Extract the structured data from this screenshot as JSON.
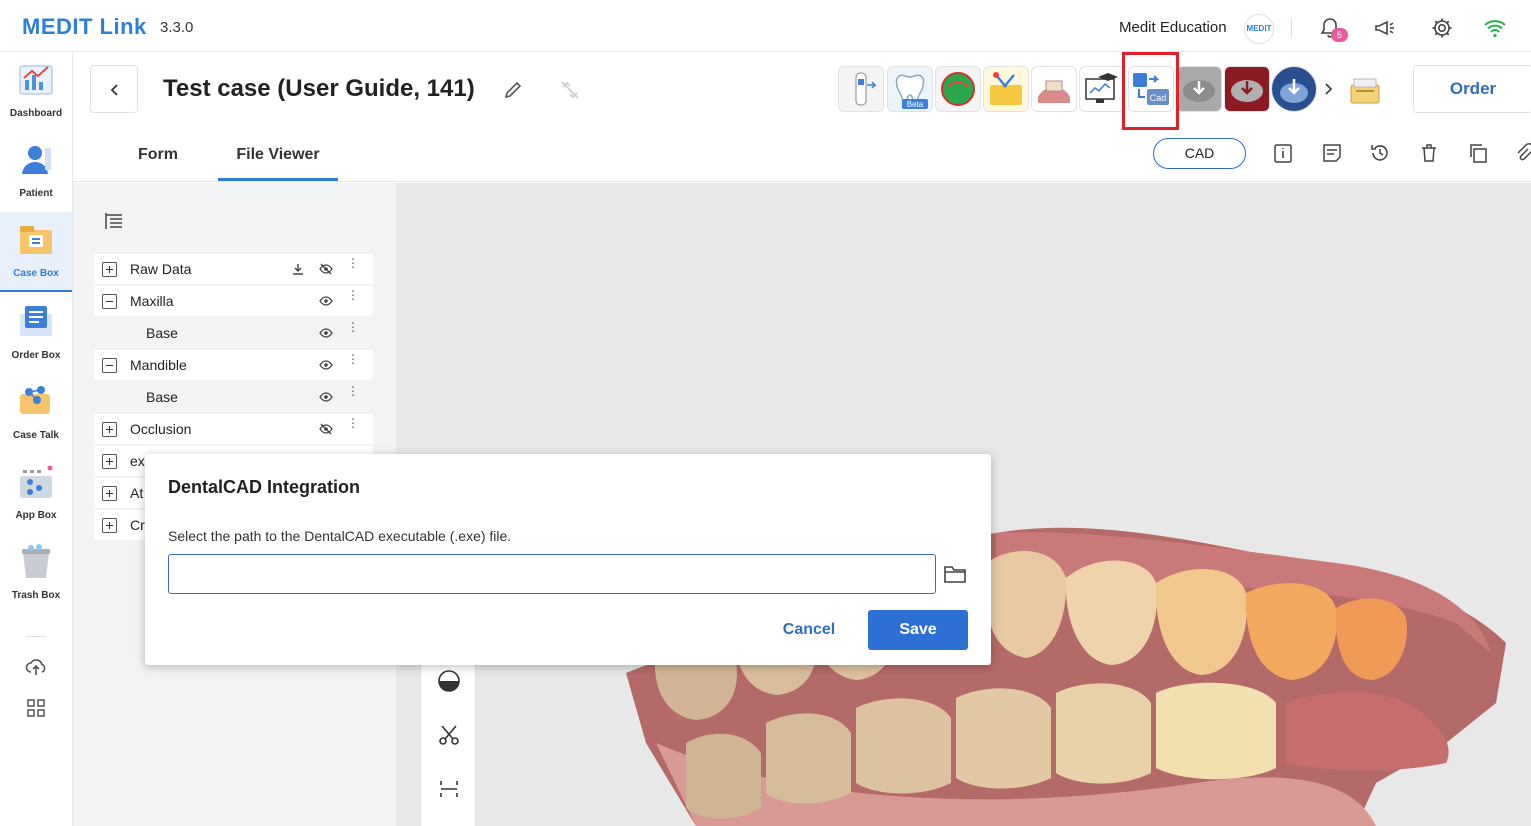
{
  "app": {
    "logo": "MEDIT Link",
    "version": "3.3.0"
  },
  "topbar": {
    "user_name": "Medit Education",
    "avatar_text": "MEDIT",
    "notification_count": "5"
  },
  "sidebar": {
    "items": [
      {
        "label": "Dashboard",
        "icon": "dashboard-icon"
      },
      {
        "label": "Patient",
        "icon": "patient-icon"
      },
      {
        "label": "Case Box",
        "icon": "case-box-icon",
        "active": true
      },
      {
        "label": "Order Box",
        "icon": "order-box-icon"
      },
      {
        "label": "Case Talk",
        "icon": "case-talk-icon"
      },
      {
        "label": "App Box",
        "icon": "app-box-icon"
      },
      {
        "label": "Trash Box",
        "icon": "trash-box-icon"
      }
    ]
  },
  "header": {
    "case_title": "Test case (User Guide, 141)",
    "apps": [
      {
        "icon": "scanner-app-icon"
      },
      {
        "icon": "tooth-beta-app-icon",
        "badge": "Beta"
      },
      {
        "icon": "green-dot-app-icon"
      },
      {
        "icon": "folder-tools-app-icon"
      },
      {
        "icon": "gum-model-app-icon"
      },
      {
        "icon": "education-app-icon"
      },
      {
        "icon": "dentalcad-app-icon",
        "badge": "Cad"
      },
      {
        "icon": "download-grey-app-icon"
      },
      {
        "icon": "download-red-app-icon"
      },
      {
        "icon": "download-blue-app-icon"
      }
    ],
    "order_label": "Order",
    "tabs": [
      {
        "label": "Form"
      },
      {
        "label": "File Viewer",
        "active": true
      }
    ],
    "cad_label": "CAD"
  },
  "tree": {
    "rows": [
      {
        "label": "Raw Data",
        "toggle": "plus",
        "has_download": true,
        "visibility": "hidden"
      },
      {
        "label": "Maxilla",
        "toggle": "minus",
        "visibility": "visible"
      },
      {
        "label": "Base",
        "sub": true,
        "visibility": "visible"
      },
      {
        "label": "Mandible",
        "toggle": "minus",
        "visibility": "visible"
      },
      {
        "label": "Base",
        "sub": true,
        "visibility": "visible"
      },
      {
        "label": "Occlusion",
        "toggle": "plus",
        "visibility": "hidden"
      },
      {
        "label": "ex",
        "toggle": "plus"
      },
      {
        "label": "At",
        "toggle": "plus"
      },
      {
        "label": "Cr",
        "toggle": "plus"
      }
    ]
  },
  "dialog": {
    "title": "DentalCAD Integration",
    "description": "Select the path to the DentalCAD executable (.exe) file.",
    "input_value": "",
    "cancel_label": "Cancel",
    "save_label": "Save"
  },
  "colors": {
    "brand": "#2e7fd6",
    "highlight": "#e0202a",
    "primary_button": "#2e6fd6"
  }
}
